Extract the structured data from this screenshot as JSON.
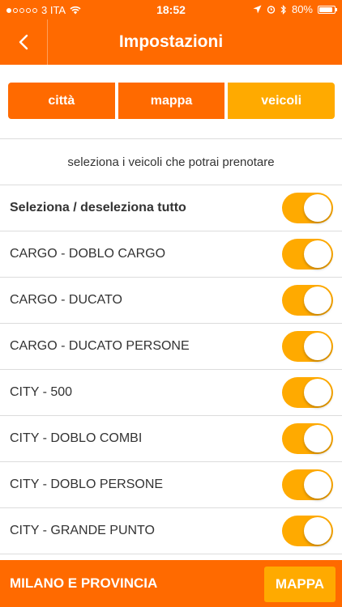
{
  "status_bar": {
    "carrier": "3 ITA",
    "time": "18:52",
    "battery": "80%"
  },
  "header": {
    "title": "Impostazioni",
    "back_icon": "chevron-left-icon"
  },
  "tabs": [
    {
      "label": "città",
      "active": false
    },
    {
      "label": "mappa",
      "active": false
    },
    {
      "label": "veicoli",
      "active": true
    }
  ],
  "subtitle": "seleziona i veicoli che potrai prenotare",
  "vehicles": [
    {
      "label": "Seleziona / deseleziona tutto",
      "on": true
    },
    {
      "label": "CARGO - DOBLO CARGO",
      "on": true
    },
    {
      "label": "CARGO - DUCATO",
      "on": true
    },
    {
      "label": "CARGO - DUCATO PERSONE",
      "on": true
    },
    {
      "label": "CITY - 500",
      "on": true
    },
    {
      "label": "CITY - DOBLO COMBI",
      "on": true
    },
    {
      "label": "CITY - DOBLO PERSONE",
      "on": true
    },
    {
      "label": "CITY - GRANDE PUNTO",
      "on": true
    }
  ],
  "footer": {
    "title": "MILANO E PROVINCIA",
    "button": "MAPPA"
  },
  "colors": {
    "primary": "#ff6a00",
    "accent": "#ffaa00"
  }
}
